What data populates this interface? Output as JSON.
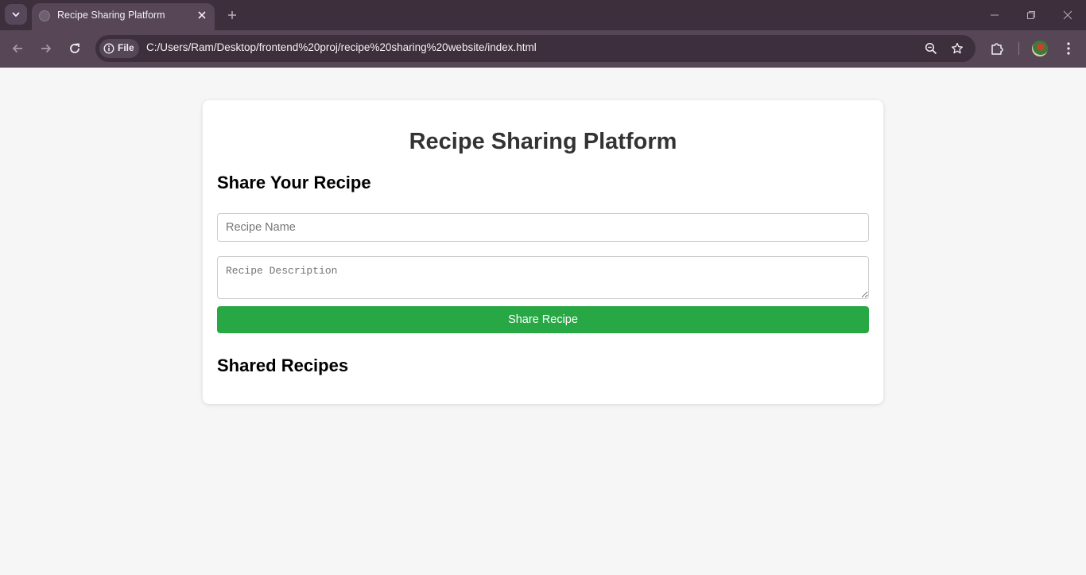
{
  "browser": {
    "tab_title": "Recipe Sharing Platform",
    "site_chip_label": "File",
    "url": "C:/Users/Ram/Desktop/frontend%20proj/recipe%20sharing%20website/index.html"
  },
  "page": {
    "title": "Recipe Sharing Platform",
    "share_section_title": "Share Your Recipe",
    "recipe_name_placeholder": "Recipe Name",
    "recipe_name_value": "",
    "recipe_description_placeholder": "Recipe Description",
    "recipe_description_value": "",
    "share_button_label": "Share Recipe",
    "shared_section_title": "Shared Recipes",
    "shared_recipes": []
  },
  "colors": {
    "page_background": "#f6f6f6",
    "card_background": "#ffffff",
    "button_background": "#28a745",
    "title_text": "#333333",
    "browser_frame": "#3d2f3c",
    "browser_toolbar": "#564656"
  }
}
